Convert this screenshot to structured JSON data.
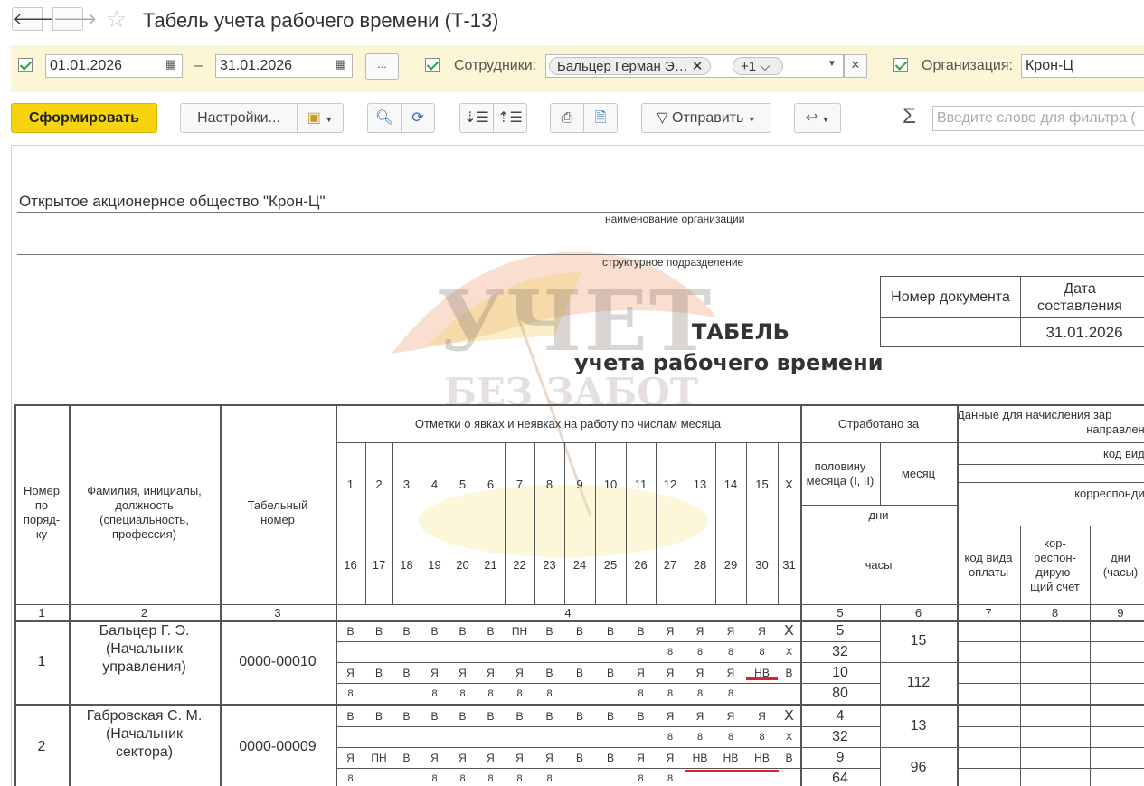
{
  "window": {
    "title": "Табель учета рабочего времени (Т-13)"
  },
  "nav": {
    "back": "🡐",
    "forward": "🡒"
  },
  "filters": {
    "date_from": "01.01.2026",
    "date_dash": "–",
    "date_to": "31.01.2026",
    "more_button": "...",
    "employees_label": "Сотрудники:",
    "employee_tag": "Бальцер Герман Э…",
    "more_tag": "+1",
    "org_label": "Организация:",
    "org_value": "Крон-Ц"
  },
  "toolbar": {
    "generate": "Сформировать",
    "settings": "Настройки...",
    "send": "Отправить",
    "search_placeholder": "Введите слово для фильтра (",
    "sigma": "Σ"
  },
  "report": {
    "org_name": "Открытое акционерное общество \"Крон-Ц\"",
    "org_caption": "наименование организации",
    "division_caption": "структурное подразделение",
    "doc_number_header": "Номер документа",
    "doc_date_header": "Дата составления",
    "doc_date": "31.01.2026",
    "title_line1": "ТАБЕЛЬ",
    "title_line2": "учета  рабочего времени",
    "headers": {
      "num": "Номер по поряд- ку",
      "name": "Фамилия, инициалы, должность (специальность, профессия)",
      "tab": "Табельный номер",
      "marks": "Отметки о явках и неявках на работу по числам месяца",
      "worked": "Отработано за",
      "half": "половину месяца (I, II)",
      "month": "месяц",
      "days": "дни",
      "hours": "часы",
      "payroll": "Данные для начисления зар",
      "payroll2": "направлени",
      "pay_kind_code": "код вида",
      "corresp": "корреспондир",
      "code_pay": "код вида оплаты",
      "corr_acc": "кор- респон- дирую- щий счет",
      "days_hours": "дни (часы)"
    },
    "col_numbers": [
      "1",
      "2",
      "3",
      "4",
      "5",
      "6",
      "7",
      "8",
      "9"
    ],
    "days_top": [
      "1",
      "2",
      "3",
      "4",
      "5",
      "6",
      "7",
      "8",
      "9",
      "10",
      "11",
      "12",
      "13",
      "14",
      "15",
      "X"
    ],
    "days_bottom": [
      "16",
      "17",
      "18",
      "19",
      "20",
      "21",
      "22",
      "23",
      "24",
      "25",
      "26",
      "27",
      "28",
      "29",
      "30",
      "31"
    ],
    "employees": [
      {
        "num": "1",
        "name": "Бальцер Г. Э. (Начальник управления)",
        "tab": "0000-00010",
        "r1": [
          "В",
          "В",
          "В",
          "В",
          "В",
          "В",
          "ПН",
          "В",
          "В",
          "В",
          "В",
          "Я",
          "Я",
          "Я",
          "Я",
          "Х"
        ],
        "r2": [
          "",
          "",
          "",
          "",
          "",
          "",
          "",
          "",
          "",
          "",
          "",
          "8",
          "8",
          "8",
          "8",
          "Х"
        ],
        "r3": [
          "Я",
          "В",
          "В",
          "Я",
          "Я",
          "Я",
          "Я",
          "В",
          "В",
          "В",
          "Я",
          "Я",
          "Я",
          "Я",
          "НВ",
          "В"
        ],
        "r4": [
          "8",
          "",
          "",
          "8",
          "8",
          "8",
          "8",
          "8",
          "",
          "",
          "8",
          "8",
          "8",
          "8",
          "",
          ""
        ],
        "half1_days": "5",
        "half1_hours": "32",
        "half2_days": "10",
        "half2_hours": "80",
        "month_days": "15",
        "month_hours": "112"
      },
      {
        "num": "2",
        "name": "Габровская С. М. (Начальник сектора)",
        "tab": "0000-00009",
        "r1": [
          "В",
          "В",
          "В",
          "В",
          "В",
          "В",
          "В",
          "В",
          "В",
          "В",
          "В",
          "Я",
          "Я",
          "Я",
          "Я",
          "Х"
        ],
        "r2": [
          "",
          "",
          "",
          "",
          "",
          "",
          "",
          "",
          "",
          "",
          "",
          "8",
          "8",
          "8",
          "8",
          "Х"
        ],
        "r3": [
          "Я",
          "ПН",
          "В",
          "Я",
          "Я",
          "Я",
          "Я",
          "Я",
          "В",
          "В",
          "Я",
          "Я",
          "НВ",
          "НВ",
          "НВ",
          "В"
        ],
        "r4": [
          "8",
          "",
          "",
          "8",
          "8",
          "8",
          "8",
          "8",
          "",
          "",
          "8",
          "8",
          "",
          "",
          "",
          ""
        ],
        "half1_days": "4",
        "half1_hours": "32",
        "half2_days": "9",
        "half2_hours": "64",
        "month_days": "13",
        "month_hours": "96"
      }
    ]
  },
  "watermark": {
    "line1": "УЧЕТ",
    "line2": "БЕЗ ЗАБОТ"
  }
}
